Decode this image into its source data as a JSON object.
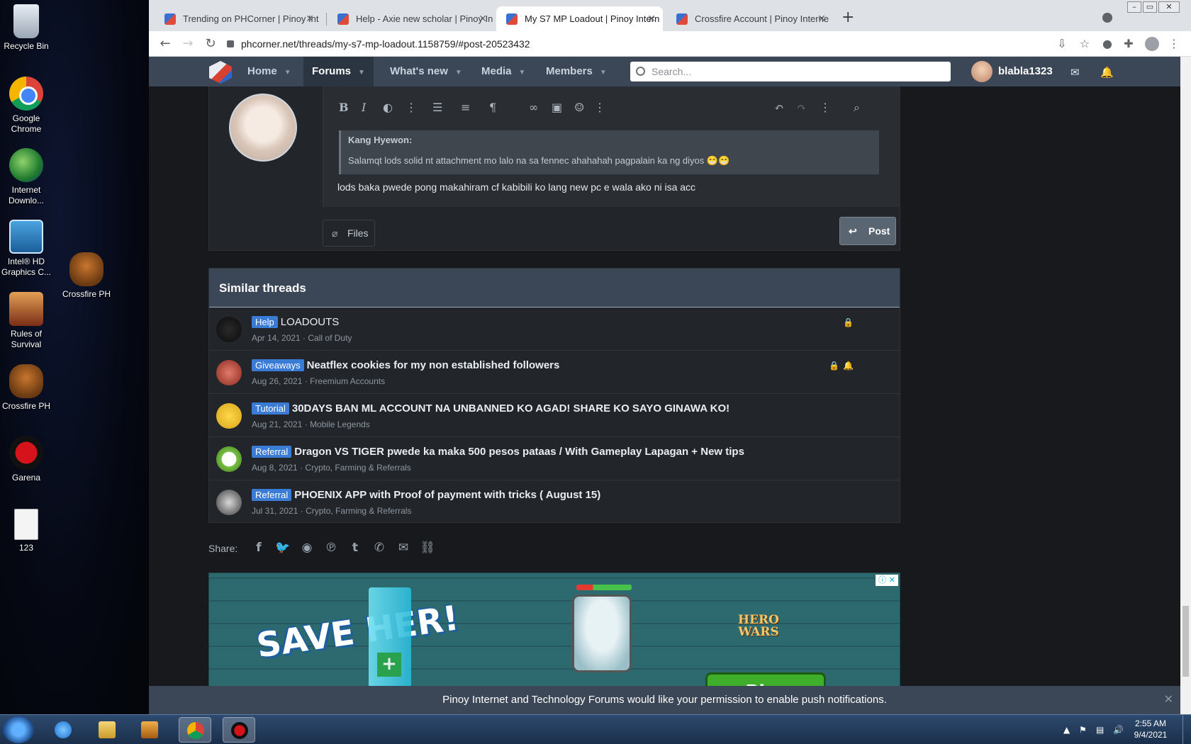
{
  "desktop": {
    "icons": [
      {
        "label": "Recycle Bin",
        "icon": "recycle-bin-icon"
      },
      {
        "label": "Google Chrome",
        "icon": "chrome-icon"
      },
      {
        "label": "Internet Downlo...",
        "icon": "internet-download-manager-icon"
      },
      {
        "label": "Intel® HD Graphics C...",
        "icon": "intel-graphics-icon"
      },
      {
        "label": "Crossfire PH",
        "icon": "crossfire-icon"
      },
      {
        "label": "Rules of Survival",
        "icon": "rules-of-survival-icon"
      },
      {
        "label": "Crossfire PH",
        "icon": "crossfire-icon"
      },
      {
        "label": "Garena",
        "icon": "garena-icon"
      },
      {
        "label": "123",
        "icon": "text-file-icon"
      }
    ]
  },
  "browser": {
    "tabs": [
      {
        "title": "Trending on PHCorner | Pinoy Int",
        "active": false
      },
      {
        "title": "Help - Axie new scholar | Pinoy In",
        "active": false
      },
      {
        "title": "My S7 MP Loadout | Pinoy Intern",
        "active": true
      },
      {
        "title": "Crossfire Account | Pinoy Interne",
        "active": false
      }
    ],
    "new_tab": "+",
    "url": "phcorner.net/threads/my-s7-mp-loadout.1158759/#post-20523432"
  },
  "forum": {
    "nav": [
      {
        "label": "Home",
        "active": false
      },
      {
        "label": "Forums",
        "active": true
      },
      {
        "label": "What's new",
        "active": false
      },
      {
        "label": "Media",
        "active": false
      },
      {
        "label": "Members",
        "active": false
      }
    ],
    "search_placeholder": "Search...",
    "username": "blabla1323"
  },
  "reply": {
    "quote_author": "Kang Hyewon:",
    "quote_text": "Salamqt lods solid nt attachment mo lalo na sa fennec ahahahah pagpalain ka ng diyos 😁😁",
    "text": "lods baka pwede pong makahiram cf kabibili ko lang new pc e wala ako ni isa acc",
    "files_label": "Files",
    "post_label": "Post"
  },
  "similar": {
    "title": "Similar threads",
    "threads": [
      {
        "prefix": "Help",
        "title": "LOADOUTS",
        "date": "Apr 14, 2021",
        "forum": "Call of Duty",
        "bold": false
      },
      {
        "prefix": "Giveaways",
        "title": "Neatflex cookies for my non established followers",
        "date": "Aug 26, 2021",
        "forum": "Freemium Accounts",
        "bold": true
      },
      {
        "prefix": "Tutorial",
        "title": "30DAYS BAN ML ACCOUNT NA UNBANNED KO AGAD! SHARE KO SAYO GINAWA KO!",
        "date": "Aug 21, 2021",
        "forum": "Mobile Legends",
        "bold": true
      },
      {
        "prefix": "Referral",
        "title": "Dragon VS TIGER pwede ka maka 500 pesos pataas / With Gameplay Lapagan + New tips",
        "date": "Aug 8, 2021",
        "forum": "Crypto, Farming & Referrals",
        "bold": true
      },
      {
        "prefix": "Referral",
        "title": "PHOENIX APP with Proof of payment with tricks ( August 15)",
        "date": "Jul 31, 2021",
        "forum": "Crypto, Farming & Referrals",
        "bold": true
      }
    ],
    "separator": " · "
  },
  "share": {
    "label": "Share:",
    "icons": [
      "facebook-icon",
      "twitter-icon",
      "reddit-icon",
      "pinterest-icon",
      "tumblr-icon",
      "whatsapp-icon",
      "email-icon",
      "link-icon"
    ]
  },
  "ad": {
    "save_text": "SAVE HER!",
    "brand": "HERO WARS",
    "play": "Pl..."
  },
  "notice": {
    "text": "Pinoy Internet and Technology Forums would like your permission to enable push notifications."
  },
  "taskbar": {
    "time": "2:55 AM",
    "date": "9/4/2021"
  },
  "colors": {
    "nav_bg": "#3b4756",
    "page_bg": "#17191c",
    "label_blue": "#3a7bd5"
  }
}
